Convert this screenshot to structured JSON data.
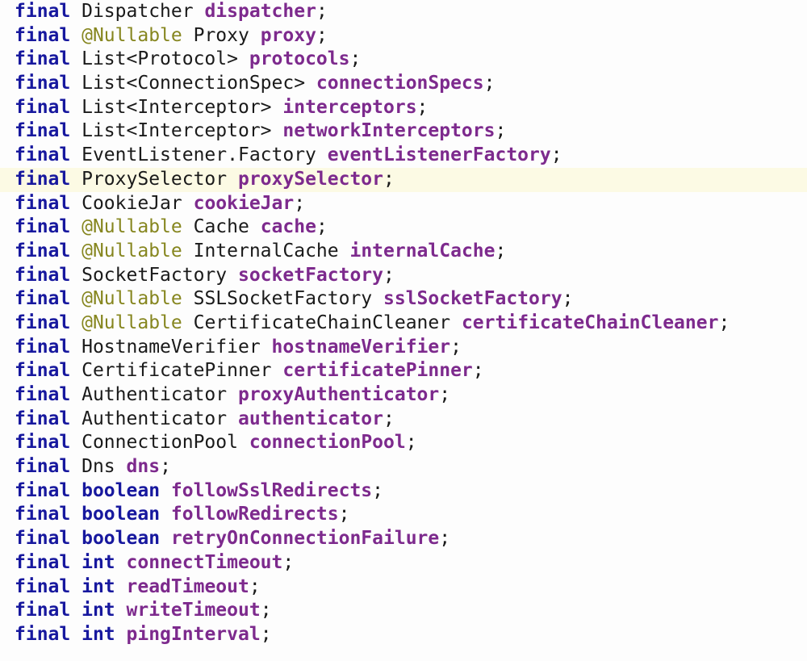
{
  "editor": {
    "language": "Java",
    "background_color": "#fdfdfd",
    "highlight_color": "#fcfae4",
    "colors": {
      "keyword": "#17189e",
      "annotation": "#86861f",
      "type": "#1a1a1a",
      "field": "#7d2a8d",
      "punctuation": "#1a1a1a"
    },
    "highlighted_line_index": 7,
    "lines": [
      {
        "index": 0,
        "text": "final Dispatcher dispatcher;",
        "highlighted": false,
        "tokens": [
          {
            "kind": "keyword",
            "text": "final"
          },
          {
            "kind": "plain",
            "text": " "
          },
          {
            "kind": "type",
            "text": "Dispatcher"
          },
          {
            "kind": "plain",
            "text": " "
          },
          {
            "kind": "field",
            "text": "dispatcher"
          },
          {
            "kind": "punct",
            "text": ";"
          }
        ]
      },
      {
        "index": 1,
        "text": "final @Nullable Proxy proxy;",
        "highlighted": false,
        "tokens": [
          {
            "kind": "keyword",
            "text": "final"
          },
          {
            "kind": "plain",
            "text": " "
          },
          {
            "kind": "annotation",
            "text": "@Nullable"
          },
          {
            "kind": "plain",
            "text": " "
          },
          {
            "kind": "type",
            "text": "Proxy"
          },
          {
            "kind": "plain",
            "text": " "
          },
          {
            "kind": "field",
            "text": "proxy"
          },
          {
            "kind": "punct",
            "text": ";"
          }
        ]
      },
      {
        "index": 2,
        "text": "final List<Protocol> protocols;",
        "highlighted": false,
        "tokens": [
          {
            "kind": "keyword",
            "text": "final"
          },
          {
            "kind": "plain",
            "text": " "
          },
          {
            "kind": "type",
            "text": "List<Protocol>"
          },
          {
            "kind": "plain",
            "text": " "
          },
          {
            "kind": "field",
            "text": "protocols"
          },
          {
            "kind": "punct",
            "text": ";"
          }
        ]
      },
      {
        "index": 3,
        "text": "final List<ConnectionSpec> connectionSpecs;",
        "highlighted": false,
        "tokens": [
          {
            "kind": "keyword",
            "text": "final"
          },
          {
            "kind": "plain",
            "text": " "
          },
          {
            "kind": "type",
            "text": "List<ConnectionSpec>"
          },
          {
            "kind": "plain",
            "text": " "
          },
          {
            "kind": "field",
            "text": "connectionSpecs"
          },
          {
            "kind": "punct",
            "text": ";"
          }
        ]
      },
      {
        "index": 4,
        "text": "final List<Interceptor> interceptors;",
        "highlighted": false,
        "tokens": [
          {
            "kind": "keyword",
            "text": "final"
          },
          {
            "kind": "plain",
            "text": " "
          },
          {
            "kind": "type",
            "text": "List<Interceptor>"
          },
          {
            "kind": "plain",
            "text": " "
          },
          {
            "kind": "field",
            "text": "interceptors"
          },
          {
            "kind": "punct",
            "text": ";"
          }
        ]
      },
      {
        "index": 5,
        "text": "final List<Interceptor> networkInterceptors;",
        "highlighted": false,
        "tokens": [
          {
            "kind": "keyword",
            "text": "final"
          },
          {
            "kind": "plain",
            "text": " "
          },
          {
            "kind": "type",
            "text": "List<Interceptor>"
          },
          {
            "kind": "plain",
            "text": " "
          },
          {
            "kind": "field",
            "text": "networkInterceptors"
          },
          {
            "kind": "punct",
            "text": ";"
          }
        ]
      },
      {
        "index": 6,
        "text": "final EventListener.Factory eventListenerFactory;",
        "highlighted": false,
        "tokens": [
          {
            "kind": "keyword",
            "text": "final"
          },
          {
            "kind": "plain",
            "text": " "
          },
          {
            "kind": "type",
            "text": "EventListener.Factory"
          },
          {
            "kind": "plain",
            "text": " "
          },
          {
            "kind": "field",
            "text": "eventListenerFactory"
          },
          {
            "kind": "punct",
            "text": ";"
          }
        ]
      },
      {
        "index": 7,
        "text": "final ProxySelector proxySelector;",
        "highlighted": true,
        "tokens": [
          {
            "kind": "keyword",
            "text": "final"
          },
          {
            "kind": "plain",
            "text": " "
          },
          {
            "kind": "type",
            "text": "ProxySelector"
          },
          {
            "kind": "plain",
            "text": " "
          },
          {
            "kind": "field",
            "text": "proxySelector"
          },
          {
            "kind": "punct",
            "text": ";"
          }
        ]
      },
      {
        "index": 8,
        "text": "final CookieJar cookieJar;",
        "highlighted": false,
        "tokens": [
          {
            "kind": "keyword",
            "text": "final"
          },
          {
            "kind": "plain",
            "text": " "
          },
          {
            "kind": "type",
            "text": "CookieJar"
          },
          {
            "kind": "plain",
            "text": " "
          },
          {
            "kind": "field",
            "text": "cookieJar"
          },
          {
            "kind": "punct",
            "text": ";"
          }
        ]
      },
      {
        "index": 9,
        "text": "final @Nullable Cache cache;",
        "highlighted": false,
        "tokens": [
          {
            "kind": "keyword",
            "text": "final"
          },
          {
            "kind": "plain",
            "text": " "
          },
          {
            "kind": "annotation",
            "text": "@Nullable"
          },
          {
            "kind": "plain",
            "text": " "
          },
          {
            "kind": "type",
            "text": "Cache"
          },
          {
            "kind": "plain",
            "text": " "
          },
          {
            "kind": "field",
            "text": "cache"
          },
          {
            "kind": "punct",
            "text": ";"
          }
        ]
      },
      {
        "index": 10,
        "text": "final @Nullable InternalCache internalCache;",
        "highlighted": false,
        "tokens": [
          {
            "kind": "keyword",
            "text": "final"
          },
          {
            "kind": "plain",
            "text": " "
          },
          {
            "kind": "annotation",
            "text": "@Nullable"
          },
          {
            "kind": "plain",
            "text": " "
          },
          {
            "kind": "type",
            "text": "InternalCache"
          },
          {
            "kind": "plain",
            "text": " "
          },
          {
            "kind": "field",
            "text": "internalCache"
          },
          {
            "kind": "punct",
            "text": ";"
          }
        ]
      },
      {
        "index": 11,
        "text": "final SocketFactory socketFactory;",
        "highlighted": false,
        "tokens": [
          {
            "kind": "keyword",
            "text": "final"
          },
          {
            "kind": "plain",
            "text": " "
          },
          {
            "kind": "type",
            "text": "SocketFactory"
          },
          {
            "kind": "plain",
            "text": " "
          },
          {
            "kind": "field",
            "text": "socketFactory"
          },
          {
            "kind": "punct",
            "text": ";"
          }
        ]
      },
      {
        "index": 12,
        "text": "final @Nullable SSLSocketFactory sslSocketFactory;",
        "highlighted": false,
        "tokens": [
          {
            "kind": "keyword",
            "text": "final"
          },
          {
            "kind": "plain",
            "text": " "
          },
          {
            "kind": "annotation",
            "text": "@Nullable"
          },
          {
            "kind": "plain",
            "text": " "
          },
          {
            "kind": "type",
            "text": "SSLSocketFactory"
          },
          {
            "kind": "plain",
            "text": " "
          },
          {
            "kind": "field",
            "text": "sslSocketFactory"
          },
          {
            "kind": "punct",
            "text": ";"
          }
        ]
      },
      {
        "index": 13,
        "text": "final @Nullable CertificateChainCleaner certificateChainCleaner;",
        "highlighted": false,
        "tokens": [
          {
            "kind": "keyword",
            "text": "final"
          },
          {
            "kind": "plain",
            "text": " "
          },
          {
            "kind": "annotation",
            "text": "@Nullable"
          },
          {
            "kind": "plain",
            "text": " "
          },
          {
            "kind": "type",
            "text": "CertificateChainCleaner"
          },
          {
            "kind": "plain",
            "text": " "
          },
          {
            "kind": "field",
            "text": "certificateChainCleaner"
          },
          {
            "kind": "punct",
            "text": ";"
          }
        ]
      },
      {
        "index": 14,
        "text": "final HostnameVerifier hostnameVerifier;",
        "highlighted": false,
        "tokens": [
          {
            "kind": "keyword",
            "text": "final"
          },
          {
            "kind": "plain",
            "text": " "
          },
          {
            "kind": "type",
            "text": "HostnameVerifier"
          },
          {
            "kind": "plain",
            "text": " "
          },
          {
            "kind": "field",
            "text": "hostnameVerifier"
          },
          {
            "kind": "punct",
            "text": ";"
          }
        ]
      },
      {
        "index": 15,
        "text": "final CertificatePinner certificatePinner;",
        "highlighted": false,
        "tokens": [
          {
            "kind": "keyword",
            "text": "final"
          },
          {
            "kind": "plain",
            "text": " "
          },
          {
            "kind": "type",
            "text": "CertificatePinner"
          },
          {
            "kind": "plain",
            "text": " "
          },
          {
            "kind": "field",
            "text": "certificatePinner"
          },
          {
            "kind": "punct",
            "text": ";"
          }
        ]
      },
      {
        "index": 16,
        "text": "final Authenticator proxyAuthenticator;",
        "highlighted": false,
        "tokens": [
          {
            "kind": "keyword",
            "text": "final"
          },
          {
            "kind": "plain",
            "text": " "
          },
          {
            "kind": "type",
            "text": "Authenticator"
          },
          {
            "kind": "plain",
            "text": " "
          },
          {
            "kind": "field",
            "text": "proxyAuthenticator"
          },
          {
            "kind": "punct",
            "text": ";"
          }
        ]
      },
      {
        "index": 17,
        "text": "final Authenticator authenticator;",
        "highlighted": false,
        "tokens": [
          {
            "kind": "keyword",
            "text": "final"
          },
          {
            "kind": "plain",
            "text": " "
          },
          {
            "kind": "type",
            "text": "Authenticator"
          },
          {
            "kind": "plain",
            "text": " "
          },
          {
            "kind": "field",
            "text": "authenticator"
          },
          {
            "kind": "punct",
            "text": ";"
          }
        ]
      },
      {
        "index": 18,
        "text": "final ConnectionPool connectionPool;",
        "highlighted": false,
        "tokens": [
          {
            "kind": "keyword",
            "text": "final"
          },
          {
            "kind": "plain",
            "text": " "
          },
          {
            "kind": "type",
            "text": "ConnectionPool"
          },
          {
            "kind": "plain",
            "text": " "
          },
          {
            "kind": "field",
            "text": "connectionPool"
          },
          {
            "kind": "punct",
            "text": ";"
          }
        ]
      },
      {
        "index": 19,
        "text": "final Dns dns;",
        "highlighted": false,
        "tokens": [
          {
            "kind": "keyword",
            "text": "final"
          },
          {
            "kind": "plain",
            "text": " "
          },
          {
            "kind": "type",
            "text": "Dns"
          },
          {
            "kind": "plain",
            "text": " "
          },
          {
            "kind": "field",
            "text": "dns"
          },
          {
            "kind": "punct",
            "text": ";"
          }
        ]
      },
      {
        "index": 20,
        "text": "final boolean followSslRedirects;",
        "highlighted": false,
        "tokens": [
          {
            "kind": "keyword",
            "text": "final"
          },
          {
            "kind": "plain",
            "text": " "
          },
          {
            "kind": "keyword",
            "text": "boolean"
          },
          {
            "kind": "plain",
            "text": " "
          },
          {
            "kind": "field",
            "text": "followSslRedirects"
          },
          {
            "kind": "punct",
            "text": ";"
          }
        ]
      },
      {
        "index": 21,
        "text": "final boolean followRedirects;",
        "highlighted": false,
        "tokens": [
          {
            "kind": "keyword",
            "text": "final"
          },
          {
            "kind": "plain",
            "text": " "
          },
          {
            "kind": "keyword",
            "text": "boolean"
          },
          {
            "kind": "plain",
            "text": " "
          },
          {
            "kind": "field",
            "text": "followRedirects"
          },
          {
            "kind": "punct",
            "text": ";"
          }
        ]
      },
      {
        "index": 22,
        "text": "final boolean retryOnConnectionFailure;",
        "highlighted": false,
        "tokens": [
          {
            "kind": "keyword",
            "text": "final"
          },
          {
            "kind": "plain",
            "text": " "
          },
          {
            "kind": "keyword",
            "text": "boolean"
          },
          {
            "kind": "plain",
            "text": " "
          },
          {
            "kind": "field",
            "text": "retryOnConnectionFailure"
          },
          {
            "kind": "punct",
            "text": ";"
          }
        ]
      },
      {
        "index": 23,
        "text": "final int connectTimeout;",
        "highlighted": false,
        "tokens": [
          {
            "kind": "keyword",
            "text": "final"
          },
          {
            "kind": "plain",
            "text": " "
          },
          {
            "kind": "keyword",
            "text": "int"
          },
          {
            "kind": "plain",
            "text": " "
          },
          {
            "kind": "field",
            "text": "connectTimeout"
          },
          {
            "kind": "punct",
            "text": ";"
          }
        ]
      },
      {
        "index": 24,
        "text": "final int readTimeout;",
        "highlighted": false,
        "tokens": [
          {
            "kind": "keyword",
            "text": "final"
          },
          {
            "kind": "plain",
            "text": " "
          },
          {
            "kind": "keyword",
            "text": "int"
          },
          {
            "kind": "plain",
            "text": " "
          },
          {
            "kind": "field",
            "text": "readTimeout"
          },
          {
            "kind": "punct",
            "text": ";"
          }
        ]
      },
      {
        "index": 25,
        "text": "final int writeTimeout;",
        "highlighted": false,
        "tokens": [
          {
            "kind": "keyword",
            "text": "final"
          },
          {
            "kind": "plain",
            "text": " "
          },
          {
            "kind": "keyword",
            "text": "int"
          },
          {
            "kind": "plain",
            "text": " "
          },
          {
            "kind": "field",
            "text": "writeTimeout"
          },
          {
            "kind": "punct",
            "text": ";"
          }
        ]
      },
      {
        "index": 26,
        "text": "final int pingInterval;",
        "highlighted": false,
        "tokens": [
          {
            "kind": "keyword",
            "text": "final"
          },
          {
            "kind": "plain",
            "text": " "
          },
          {
            "kind": "keyword",
            "text": "int"
          },
          {
            "kind": "plain",
            "text": " "
          },
          {
            "kind": "field",
            "text": "pingInterval"
          },
          {
            "kind": "punct",
            "text": ";"
          }
        ]
      }
    ]
  }
}
